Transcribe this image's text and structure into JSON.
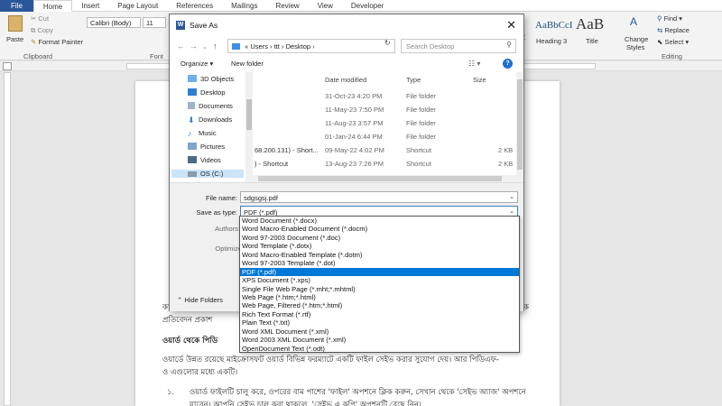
{
  "ribbon": {
    "tabs": [
      "File",
      "Home",
      "Insert",
      "Page Layout",
      "References",
      "Mailings",
      "Review",
      "View",
      "Developer"
    ],
    "paste": "Paste",
    "cut": "Cut",
    "copy": "Copy",
    "format_painter": "Format Painter",
    "clipboard": "Clipboard",
    "font_name": "Calibri (Body)",
    "font_size": "11",
    "font_group": "Font",
    "style_sample_1": "AaBbCcI",
    "style_sample_2": "AaB",
    "style_1": "Heading 3",
    "style_2": "Title",
    "change_styles_1": "Change",
    "change_styles_2": "Styles",
    "find": "Find",
    "replace": "Replace",
    "select": "Select",
    "editing": "Editing",
    "style_partial": "2"
  },
  "document": {
    "line1": "কারণে এখন বেশিরভাগ ক্ষেত্রে সকল ধরনের",
    "line1_end": "ক",
    "line2": "প্রতিবেদন প্রকাশ",
    "heading": "ওয়ার্ড থেকে পিডি",
    "para1": "ওয়ার্ডে উন্নত রয়েছে মাইক্রোসফট ওয়ার্ড বিভিন্ন ফরম্যাটে একটি ফাইল সেইভ করার সুযোগ দেয়। আর পিডিএফ-",
    "para2": "ও এগুলোর মধ্যে একটি।",
    "num": "১.",
    "para3": "ওয়ার্ড ফাইলটি চালু করে, ওপরের বাম পাশের 'ফাইল' অপশনে ক্লিক করুন, সেখান থেকে 'সেইভ অ্যাজ' অপশনে",
    "para4": "যাবেন। আপনি সেইভ চালু করা থাকলে, 'সেইভ এ কপি' অপশনটি বেছে নিন।"
  },
  "dialog": {
    "title": "Save As",
    "breadcrumb": [
      "Users",
      "ttt",
      "Desktop"
    ],
    "search_placeholder": "Search Desktop",
    "organize": "Organize",
    "new_folder": "New folder",
    "nav_items": [
      "3D Objects",
      "Desktop",
      "Documents",
      "Downloads",
      "Music",
      "Pictures",
      "Videos",
      "OS (C:)"
    ],
    "columns": {
      "date": "Date modified",
      "type": "Type",
      "size": "Size"
    },
    "files": [
      {
        "name": "",
        "date": "31-Oct-23 4:20 PM",
        "type": "File folder",
        "size": ""
      },
      {
        "name": "",
        "date": "11-May-23 7:50 PM",
        "type": "File folder",
        "size": ""
      },
      {
        "name": "",
        "date": "11-Aug-23 3:57 PM",
        "type": "File folder",
        "size": ""
      },
      {
        "name": "",
        "date": "01-Jan-24 6:44 PM",
        "type": "File folder",
        "size": ""
      },
      {
        "name": "68.200.131) - Short...",
        "date": "09-May-22 4:02 PM",
        "type": "Shortcut",
        "size": "2 KB"
      },
      {
        "name": ") - Shortcut",
        "date": "13-Aug-23 7:26 PM",
        "type": "Shortcut",
        "size": "2 KB"
      }
    ],
    "file_name_label": "File name:",
    "file_name_value": "sdgsgsj.pdf",
    "save_type_label": "Save as type:",
    "save_type_value": "PDF (*.pdf)",
    "authors_label": "Authors:",
    "optimize_label": "Optimize",
    "hide_folders": "Hide Folders"
  },
  "save_types": [
    "Word Document (*.docx)",
    "Word Macro-Enabled Document (*.docm)",
    "Word 97-2003 Document (*.doc)",
    "Word Template (*.dotx)",
    "Word Macro-Enabled Template (*.dotm)",
    "Word 97-2003 Template (*.dot)",
    "PDF (*.pdf)",
    "XPS Document (*.xps)",
    "Single File Web Page (*.mht;*.mhtml)",
    "Web Page (*.htm;*.html)",
    "Web Page, Filtered (*.htm;*.html)",
    "Rich Text Format (*.rtf)",
    "Plain Text (*.txt)",
    "Word XML Document (*.xml)",
    "Word 2003 XML Document (*.xml)",
    "OpenDocument Text (*.odt)"
  ],
  "selected_save_type": 6,
  "colors": {
    "word_blue": "#2b579a",
    "selection_blue": "#0078d7",
    "nav_selection": "#cce4f7"
  }
}
